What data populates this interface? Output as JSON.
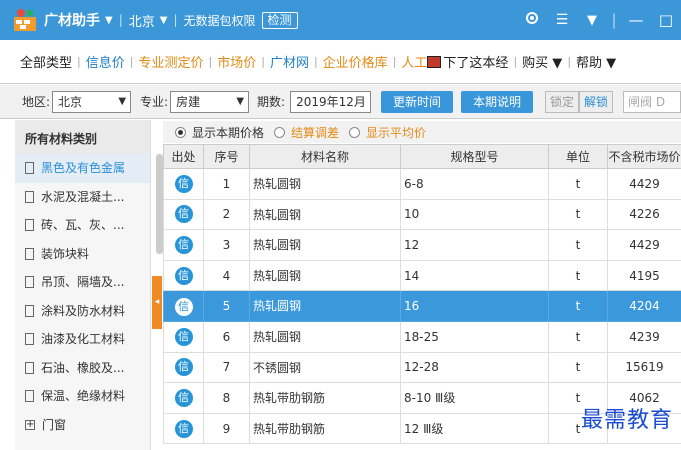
{
  "titlebar": {
    "app_title": "广材助手",
    "city": "北京",
    "no_data_pkg": "无数据包权限",
    "check_label": "检测",
    "icons": [
      "target-icon",
      "grid-icon",
      "dropdown-icon",
      "minimize-icon",
      "maximize-icon"
    ]
  },
  "menu": {
    "items": [
      {
        "label": "全部类型",
        "color": "dark"
      },
      {
        "label": "信息价",
        "color": "blue"
      },
      {
        "label": "专业测定价",
        "color": "orange"
      },
      {
        "label": "市场价",
        "color": "orange"
      },
      {
        "label": "广材网",
        "color": "blue"
      },
      {
        "label": "企业价格库",
        "color": "orange"
      },
      {
        "label": "人工",
        "color": "orange"
      }
    ],
    "notice": "下了这本经",
    "buy": "购买",
    "help": "帮助"
  },
  "filter": {
    "region_label": "地区:",
    "region_value": "北京",
    "major_label": "专业:",
    "major_value": "房建",
    "period_label": "期数:",
    "period_value": "2019年12月",
    "update_time": "更新时间",
    "period_note": "本期说明",
    "lock": "锁定",
    "unlock": "解锁",
    "extra_placeholder": "闸阀 D"
  },
  "sidebar": {
    "header": "所有材料类别",
    "items": [
      {
        "label": "黑色及有色金属",
        "type": "doc",
        "active": true
      },
      {
        "label": "水泥及混凝土...",
        "type": "doc"
      },
      {
        "label": "砖、瓦、灰、...",
        "type": "doc"
      },
      {
        "label": "装饰块料",
        "type": "doc"
      },
      {
        "label": "吊顶、隔墙及...",
        "type": "doc"
      },
      {
        "label": "涂料及防水材料",
        "type": "doc"
      },
      {
        "label": "油漆及化工材料",
        "type": "doc"
      },
      {
        "label": "石油、橡胶及...",
        "type": "doc"
      },
      {
        "label": "保温、绝缘材料",
        "type": "doc"
      },
      {
        "label": "门窗",
        "type": "plus"
      }
    ]
  },
  "radios": [
    {
      "label": "显示本期价格",
      "on": true,
      "color": "dark"
    },
    {
      "label": "结算调差",
      "on": false,
      "color": "orange"
    },
    {
      "label": "显示平均价",
      "on": false,
      "color": "orange"
    }
  ],
  "table": {
    "headers": [
      "出处",
      "序号",
      "材料名称",
      "规格型号",
      "单位",
      "不含税市场价"
    ],
    "source_icon_text": "信",
    "selected_row": 4,
    "rows": [
      [
        "1",
        "热轧圆钢",
        "6-8",
        "t",
        "4429"
      ],
      [
        "2",
        "热轧圆钢",
        "10",
        "t",
        "4226"
      ],
      [
        "3",
        "热轧圆钢",
        "12",
        "t",
        "4429"
      ],
      [
        "4",
        "热轧圆钢",
        "14",
        "t",
        "4195"
      ],
      [
        "5",
        "热轧圆钢",
        "16",
        "t",
        "4204"
      ],
      [
        "6",
        "热轧圆钢",
        "18-25",
        "t",
        "4239"
      ],
      [
        "7",
        "不锈圆钢",
        "12-28",
        "t",
        "15619"
      ],
      [
        "8",
        "热轧带肋钢筋",
        "8-10 Ⅲ级",
        "t",
        "4062"
      ],
      [
        "9",
        "热轧带肋钢筋",
        "12 Ⅲ级",
        "t",
        ""
      ]
    ]
  },
  "watermark": "最需教育"
}
